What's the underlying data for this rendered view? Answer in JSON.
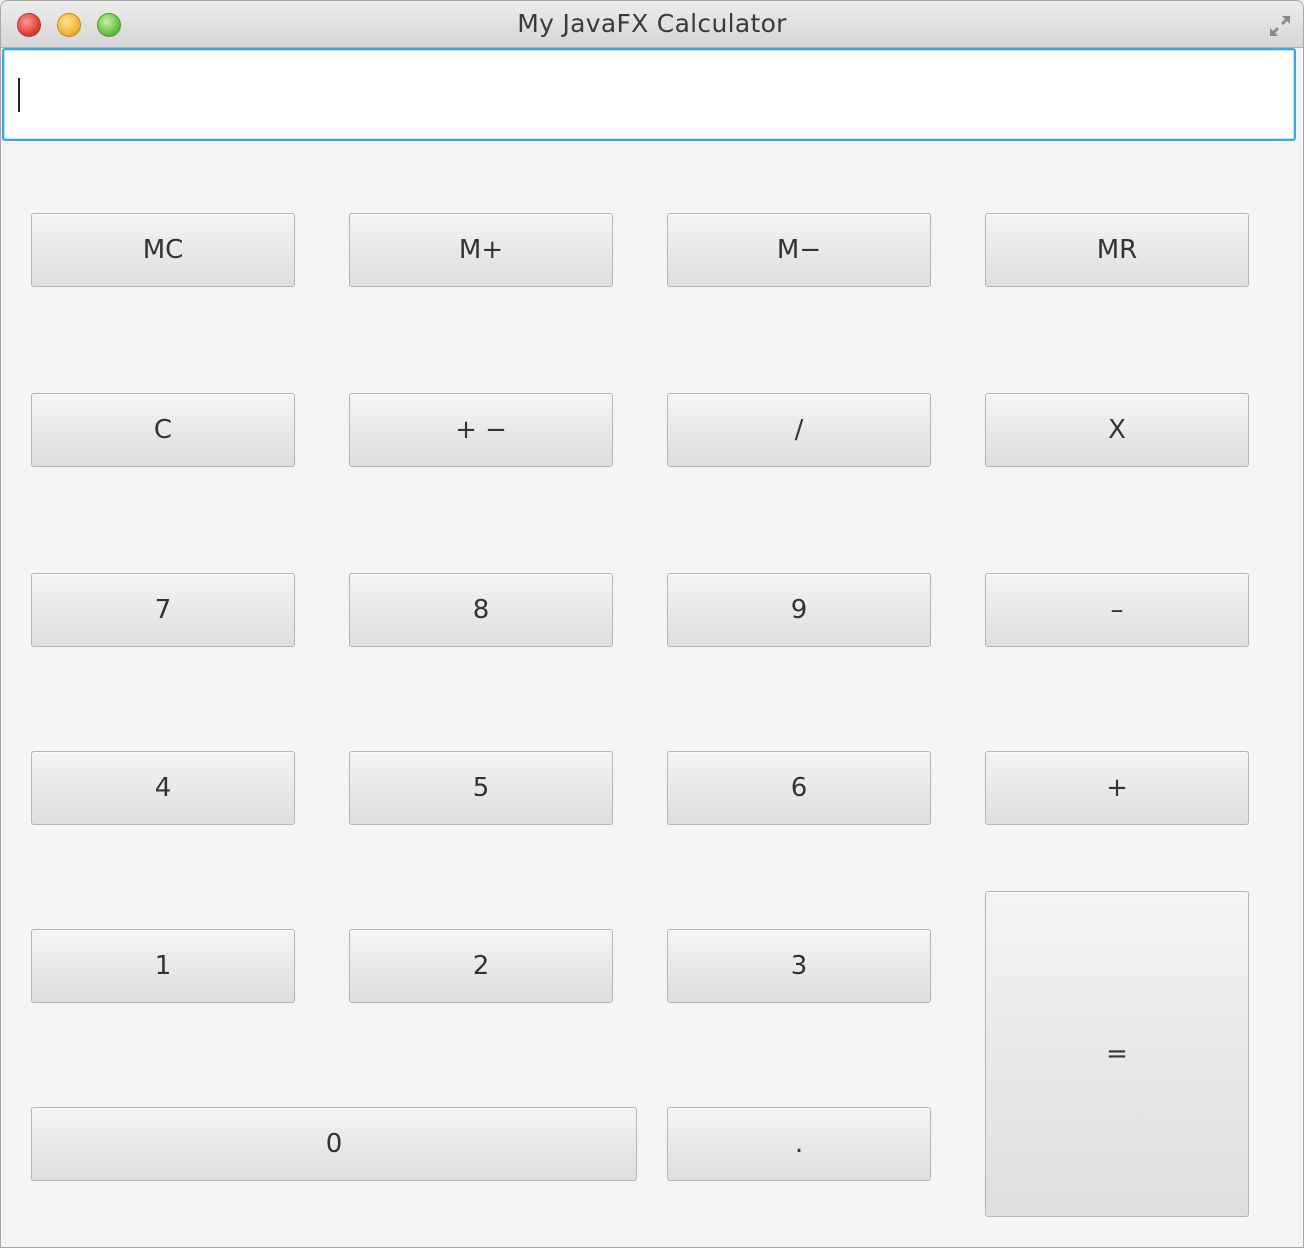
{
  "window": {
    "title": "My JavaFX Calculator"
  },
  "display": {
    "value": ""
  },
  "buttons": {
    "mc": "MC",
    "m_plus": "M+",
    "m_minus": "M−",
    "mr": "MR",
    "clear": "C",
    "plus_minus": "+ −",
    "divide": "/",
    "multiply": "X",
    "seven": "7",
    "eight": "8",
    "nine": "9",
    "subtract": "–",
    "four": "4",
    "five": "5",
    "six": "6",
    "add": "+",
    "one": "1",
    "two": "2",
    "three": "3",
    "zero": "0",
    "decimal": ".",
    "equals": "="
  },
  "colors": {
    "focus_border": "#39a9dc",
    "button_border": "#b4b4b4",
    "window_background": "#f4f4f4"
  }
}
